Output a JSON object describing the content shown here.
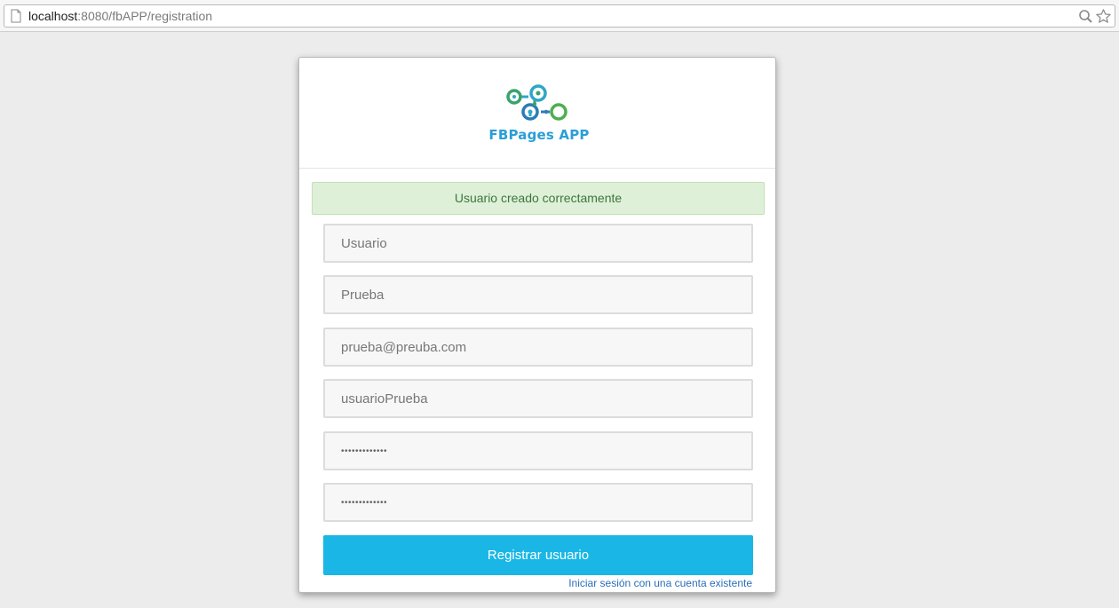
{
  "browser": {
    "url_host": "localhost",
    "url_rest": ":8080/fbAPP/registration"
  },
  "logo": {
    "text": "FBPages APP"
  },
  "alert": {
    "message": "Usuario creado correctamente"
  },
  "form": {
    "fields": [
      {
        "value": "Usuario"
      },
      {
        "value": "Prueba"
      },
      {
        "value": "prueba@preuba.com"
      },
      {
        "value": "usuarioPrueba"
      },
      {
        "value": "•••••••••••••"
      },
      {
        "value": "•••••••••••••"
      }
    ],
    "submit_label": "Registrar usuario",
    "login_link": "Iniciar sesión con una cuenta existente"
  },
  "colors": {
    "accent": "#1ab7e6",
    "success_bg": "#dff0d8",
    "success_text": "#3c763d",
    "link": "#2a6ebb"
  }
}
